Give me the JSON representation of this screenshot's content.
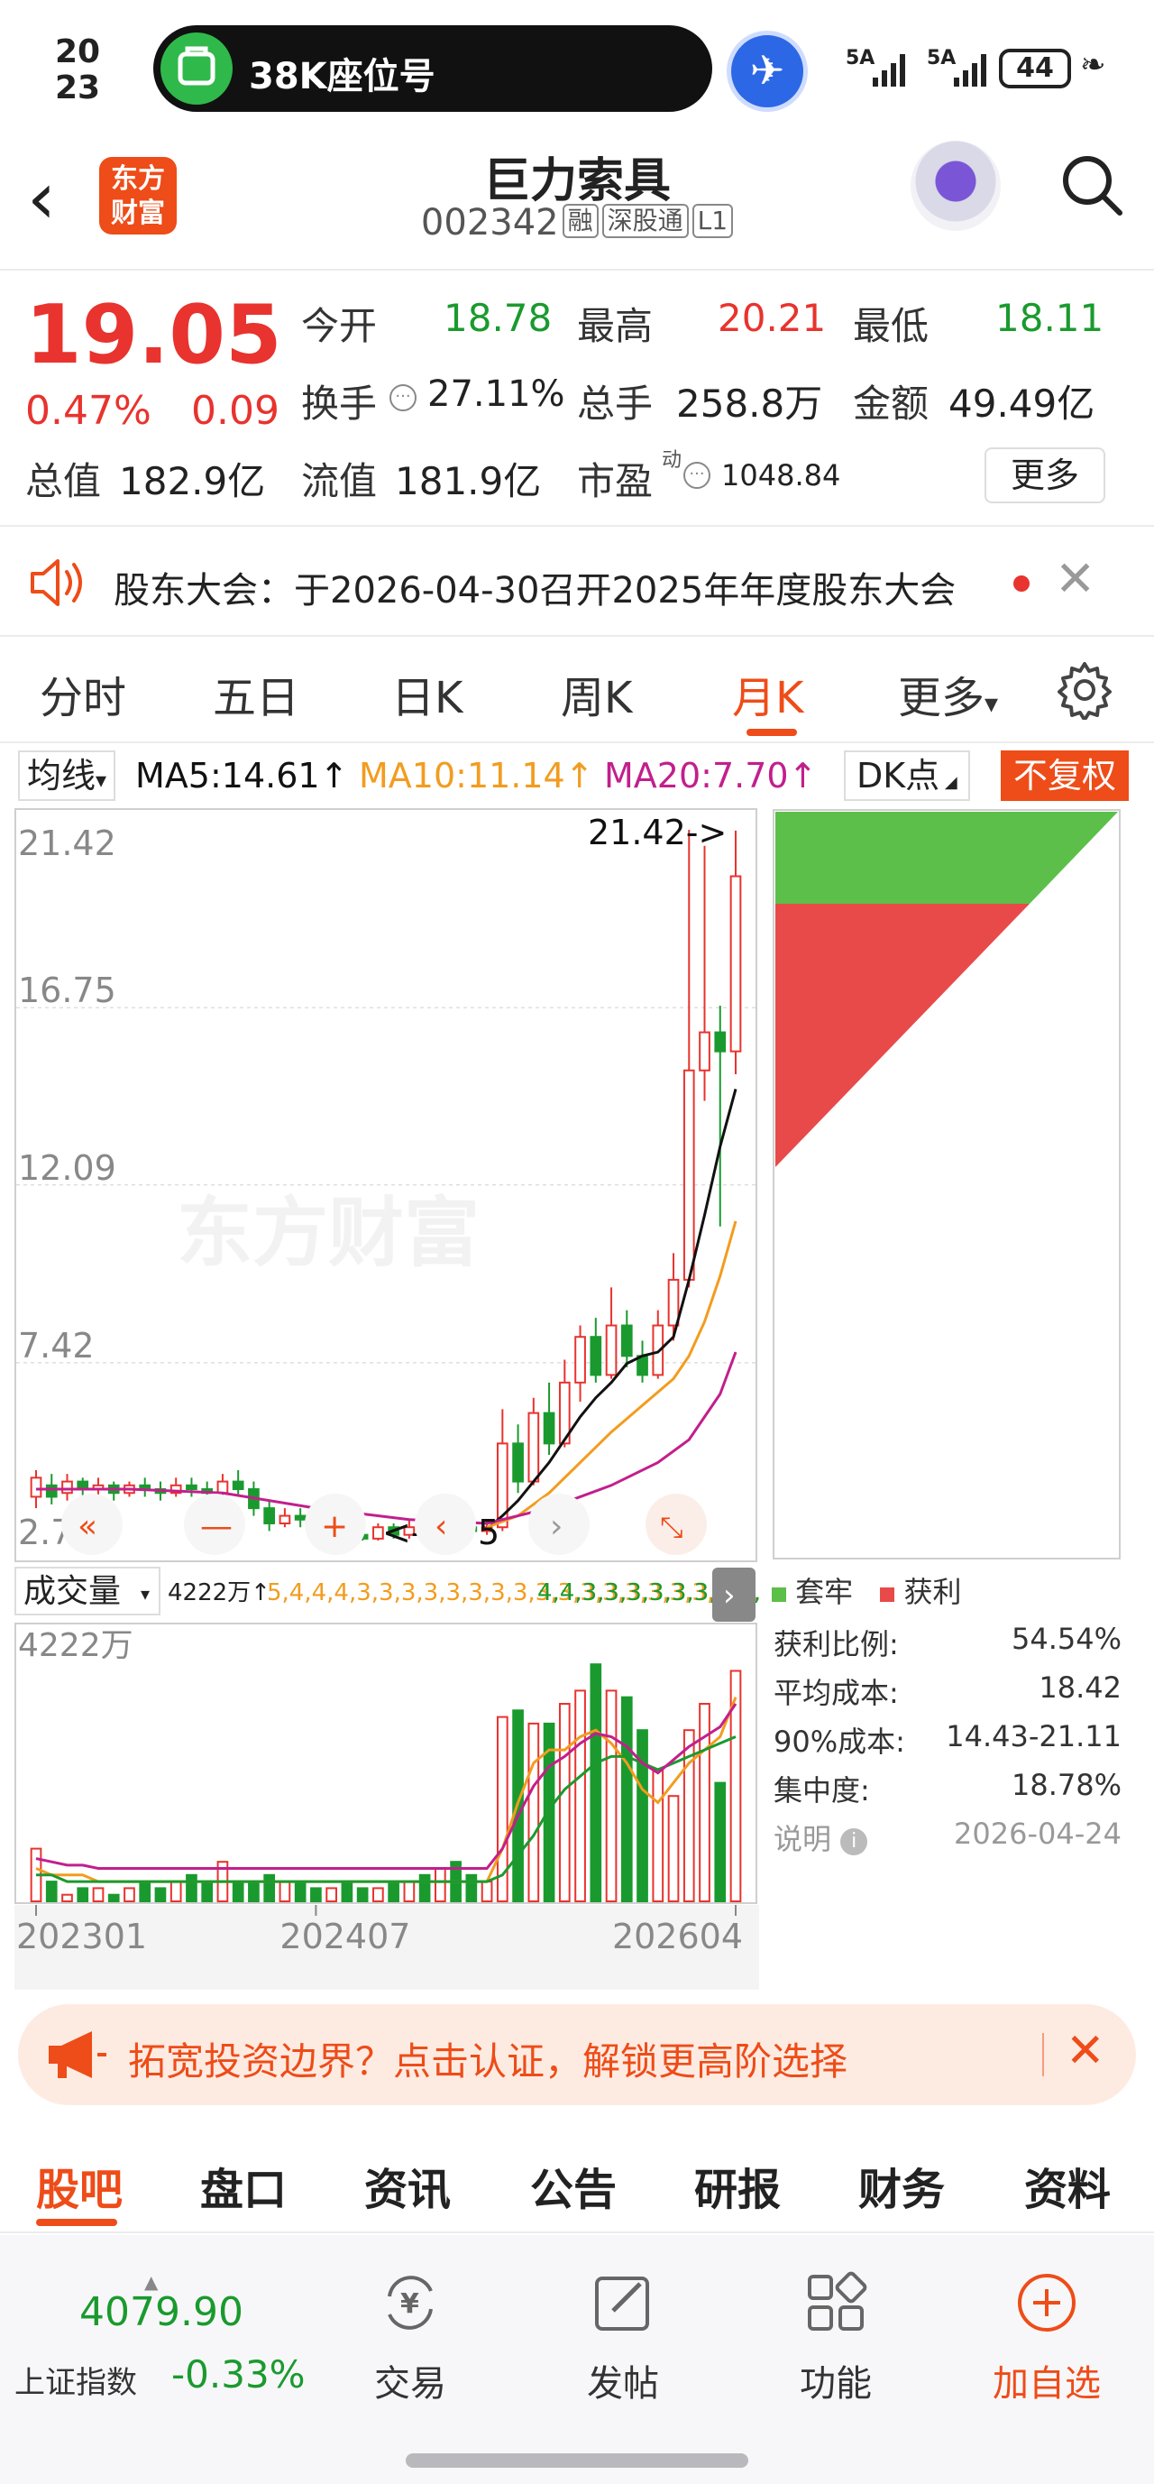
{
  "status": {
    "clock_top": "20",
    "clock_bottom": "23",
    "pill_text": "38K座位号",
    "sig1": "5A",
    "sig2": "5A",
    "battery": "44"
  },
  "header": {
    "logo_line1": "东方",
    "logo_line2": "财富",
    "title": "巨力索具",
    "code": "002342",
    "tags": [
      "融",
      "深股通",
      "L1"
    ]
  },
  "quote": {
    "price": "19.05",
    "pct": "0.47%",
    "change": "0.09",
    "rows": [
      [
        {
          "label": "今开",
          "value": "18.78",
          "color": "green"
        },
        {
          "label": "最高",
          "value": "20.21",
          "color": "red"
        },
        {
          "label": "最低",
          "value": "18.11",
          "color": "green"
        }
      ],
      [
        {
          "label": "换手",
          "value": "27.11%",
          "color": "dark"
        },
        {
          "label": "总手",
          "value": "258.8万",
          "color": "dark"
        },
        {
          "label": "金额",
          "value": "49.49亿",
          "color": "dark"
        }
      ],
      [
        {
          "label": "总值",
          "value": "182.9亿",
          "color": "dark"
        },
        {
          "label": "流值",
          "value": "181.9亿",
          "color": "dark"
        },
        {
          "label": "市盈",
          "value": "1048.84",
          "color": "dark"
        }
      ]
    ],
    "pe_sup": "动",
    "more": "更多"
  },
  "notice": {
    "text": "股东大会：于2026-04-30召开2025年年度股东大会"
  },
  "tabs": [
    "分时",
    "五日",
    "日K",
    "周K",
    "月K",
    "更多"
  ],
  "active_tab": 4,
  "ma_row": {
    "select": "均线",
    "ma5": "MA5:14.61",
    "ma10": "MA10:11.14",
    "ma20": "MA20:7.70",
    "dk": "DK点",
    "fq": "不复权"
  },
  "colors": {
    "up": "#e8332e",
    "down": "#1a9a2e",
    "accent": "#ee4c18",
    "ma5": "#111111",
    "ma10": "#f29c1f",
    "ma20": "#c21f8c"
  },
  "chart_data": {
    "type": "candlestick",
    "y_ticks": [
      "21.42",
      "16.75",
      "12.09",
      "7.42",
      "2.75"
    ],
    "ylim": [
      2.75,
      21.42
    ],
    "high_marker": "21.42->",
    "low_marker": "<-2.75",
    "x_labels": [
      "202301",
      "202407",
      "202604"
    ],
    "watermark": "东方财富",
    "candles": [
      [
        3.9,
        4.4,
        3.6,
        4.6
      ],
      [
        4.2,
        3.9,
        3.7,
        4.5
      ],
      [
        4.0,
        4.3,
        3.8,
        4.5
      ],
      [
        4.3,
        4.1,
        3.9,
        4.4
      ],
      [
        4.1,
        4.2,
        3.9,
        4.4
      ],
      [
        4.2,
        4.0,
        3.8,
        4.3
      ],
      [
        4.0,
        4.2,
        3.9,
        4.3
      ],
      [
        4.2,
        4.1,
        3.9,
        4.4
      ],
      [
        4.1,
        4.0,
        3.8,
        4.3
      ],
      [
        4.0,
        4.2,
        3.9,
        4.4
      ],
      [
        4.2,
        4.1,
        3.9,
        4.4
      ],
      [
        4.1,
        4.0,
        3.8,
        4.3
      ],
      [
        4.0,
        4.3,
        3.9,
        4.5
      ],
      [
        4.3,
        4.1,
        3.9,
        4.6
      ],
      [
        4.1,
        3.6,
        3.4,
        4.3
      ],
      [
        3.6,
        3.2,
        3.0,
        3.8
      ],
      [
        3.2,
        3.4,
        3.1,
        3.6
      ],
      [
        3.4,
        3.3,
        3.1,
        3.6
      ],
      [
        3.3,
        3.0,
        2.9,
        3.5
      ],
      [
        3.0,
        3.3,
        2.9,
        3.5
      ],
      [
        3.3,
        2.9,
        2.8,
        3.4
      ],
      [
        2.9,
        2.8,
        2.75,
        3.1
      ],
      [
        2.8,
        3.1,
        2.75,
        3.2
      ],
      [
        3.1,
        2.9,
        2.8,
        3.2
      ],
      [
        2.9,
        3.1,
        2.8,
        3.3
      ],
      [
        3.1,
        3.0,
        2.9,
        3.5
      ],
      [
        3.0,
        3.2,
        2.9,
        3.6
      ],
      [
        3.2,
        3.1,
        3.0,
        3.4
      ],
      [
        3.1,
        3.0,
        2.9,
        3.3
      ],
      [
        3.0,
        3.1,
        2.9,
        3.3
      ],
      [
        3.1,
        5.3,
        3.0,
        6.2
      ],
      [
        5.3,
        4.3,
        4.0,
        5.8
      ],
      [
        4.3,
        6.1,
        4.2,
        6.5
      ],
      [
        6.1,
        5.3,
        5.0,
        6.9
      ],
      [
        5.3,
        6.9,
        5.2,
        7.5
      ],
      [
        6.9,
        8.1,
        6.4,
        8.4
      ],
      [
        8.1,
        7.1,
        6.9,
        8.6
      ],
      [
        7.1,
        8.4,
        7.0,
        9.4
      ],
      [
        8.4,
        7.6,
        7.3,
        8.8
      ],
      [
        7.6,
        7.1,
        6.9,
        8.0
      ],
      [
        7.1,
        8.4,
        7.0,
        8.8
      ],
      [
        8.4,
        9.6,
        8.0,
        10.3
      ],
      [
        9.6,
        15.1,
        9.4,
        21.42
      ],
      [
        15.1,
        16.1,
        14.3,
        21.0
      ],
      [
        16.1,
        15.6,
        11.0,
        16.8
      ],
      [
        15.6,
        20.2,
        15.0,
        21.4
      ]
    ],
    "ma_lines": {
      "ma5": [
        [
          29,
          3.05
        ],
        [
          30,
          3.4
        ],
        [
          31,
          3.8
        ],
        [
          32,
          4.3
        ],
        [
          33,
          4.8
        ],
        [
          34,
          5.4
        ],
        [
          35,
          6.0
        ],
        [
          36,
          6.5
        ],
        [
          37,
          6.9
        ],
        [
          38,
          7.4
        ],
        [
          39,
          7.6
        ],
        [
          40,
          7.7
        ],
        [
          41,
          8.1
        ],
        [
          42,
          9.6
        ],
        [
          43,
          11.3
        ],
        [
          44,
          13.1
        ],
        [
          45,
          14.61
        ]
      ],
      "ma10": [
        [
          29,
          3.1
        ],
        [
          31,
          3.4
        ],
        [
          33,
          4.0
        ],
        [
          35,
          4.8
        ],
        [
          37,
          5.6
        ],
        [
          39,
          6.3
        ],
        [
          41,
          7.0
        ],
        [
          42,
          7.6
        ],
        [
          43,
          8.5
        ],
        [
          44,
          9.7
        ],
        [
          45,
          11.14
        ]
      ],
      "ma20": [
        [
          0,
          4.1
        ],
        [
          6,
          4.1
        ],
        [
          12,
          4.0
        ],
        [
          18,
          3.6
        ],
        [
          24,
          3.3
        ],
        [
          29,
          3.2
        ],
        [
          33,
          3.6
        ],
        [
          37,
          4.2
        ],
        [
          40,
          4.8
        ],
        [
          42,
          5.4
        ],
        [
          44,
          6.6
        ],
        [
          45,
          7.7
        ]
      ]
    }
  },
  "volume": {
    "label": "成交量",
    "max_text": "4222万",
    "vol": "4222万",
    "ma1": [
      5,
      4,
      4,
      4,
      3,
      3,
      3,
      3,
      3,
      3,
      3,
      3,
      3,
      3,
      3,
      3,
      3,
      3,
      3,
      3,
      3,
      3,
      3,
      3,
      3,
      3,
      3,
      3,
      3,
      3,
      8,
      15,
      21,
      23,
      23,
      25,
      26,
      24,
      21,
      17,
      15,
      18,
      21,
      23,
      25,
      31
    ],
    "ma3": [
      4,
      4,
      3,
      3,
      3,
      3,
      3,
      3,
      3,
      3,
      3,
      3,
      3,
      3,
      3,
      3,
      3,
      3,
      3,
      3,
      3,
      3,
      3,
      3,
      3,
      3,
      3,
      3,
      3,
      3,
      4,
      7,
      10,
      14,
      17,
      19,
      21,
      22,
      22,
      21,
      20,
      21,
      22,
      23,
      24,
      25
    ],
    "bars": [
      8,
      3,
      1,
      2,
      2,
      1,
      2,
      3,
      2,
      3,
      4,
      3,
      6,
      3,
      3,
      4,
      3,
      3,
      2,
      2,
      3,
      2,
      2,
      3,
      3,
      4,
      5,
      6,
      4,
      3,
      28,
      29,
      27,
      27,
      30,
      32,
      36,
      32,
      31,
      26,
      20,
      16,
      26,
      30,
      18,
      35
    ]
  },
  "chips": {
    "legend_trap": "套牢",
    "legend_profit": "获利",
    "stats": [
      {
        "label": "获利比例:",
        "value": "54.54%"
      },
      {
        "label": "平均成本:",
        "value": "18.42"
      },
      {
        "label": "90%成本:",
        "value": "14.43-21.11"
      },
      {
        "label": "集中度:",
        "value": "18.78%"
      }
    ],
    "explain": "说明",
    "date": "2026-04-24"
  },
  "promo": {
    "text": "拓宽投资边界？点击认证，解锁更高阶选择"
  },
  "bottom_tabs": [
    "股吧",
    "盘口",
    "资讯",
    "公告",
    "研报",
    "财务",
    "资料"
  ],
  "footer": {
    "index_value": "4079.90",
    "index_name": "上证指数",
    "index_change": "-0.33%",
    "items": [
      {
        "label": "交易",
        "icon": "yen-exchange-icon"
      },
      {
        "label": "发帖",
        "icon": "edit-icon"
      },
      {
        "label": "功能",
        "icon": "grid-icon"
      },
      {
        "label": "加自选",
        "icon": "add-circle-icon"
      }
    ]
  }
}
